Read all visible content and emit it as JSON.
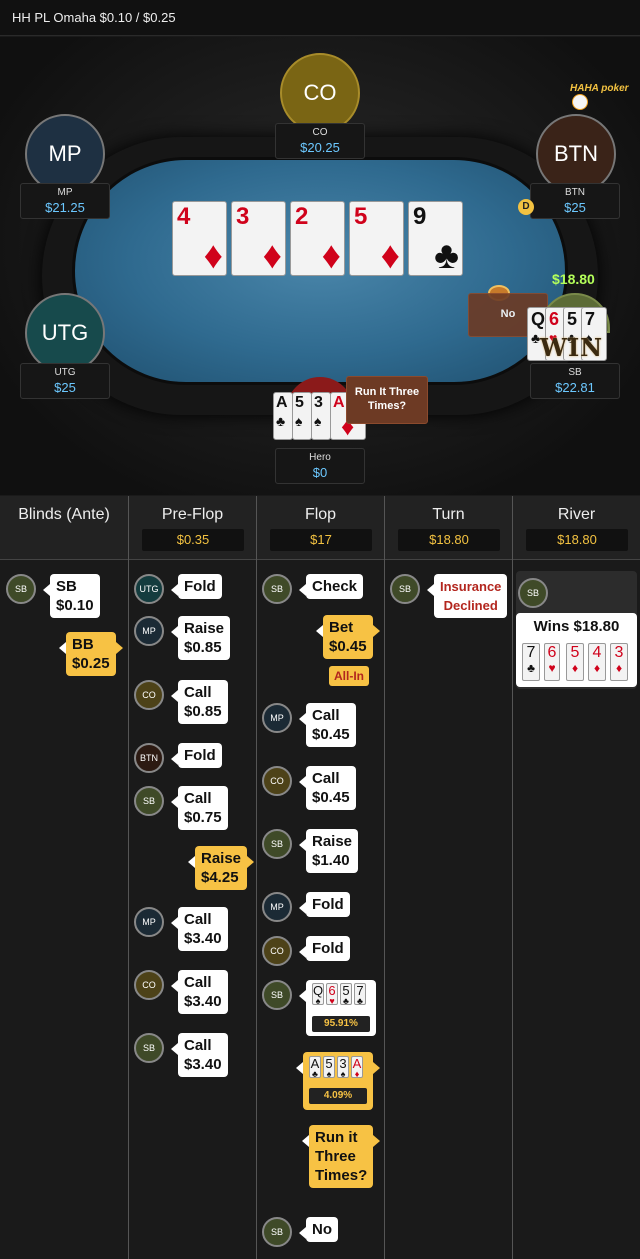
{
  "header": {
    "title": "HH PL Omaha $0.10 / $0.25"
  },
  "logo": {
    "text": "HAHA poker"
  },
  "seats": {
    "co": {
      "label": "CO",
      "name": "CO",
      "stack": "$20.25"
    },
    "mp": {
      "label": "MP",
      "name": "MP",
      "stack": "$21.25"
    },
    "btn": {
      "label": "BTN",
      "name": "BTN",
      "stack": "$25"
    },
    "utg": {
      "label": "UTG",
      "name": "UTG",
      "stack": "$25"
    },
    "sb": {
      "name": "SB",
      "stack": "$22.81",
      "cards": [
        "Q",
        "6",
        "5",
        "7"
      ],
      "win_label": "WIN",
      "pot_won": "$18.80"
    },
    "hero": {
      "name": "Hero",
      "stack": "$0",
      "cards": [
        "A",
        "5",
        "3",
        "A"
      ]
    }
  },
  "dealer": "D",
  "board": [
    {
      "rank": "4",
      "suit": "♦",
      "color": "#d0021b"
    },
    {
      "rank": "3",
      "suit": "♦",
      "color": "#d0021b"
    },
    {
      "rank": "2",
      "suit": "♦",
      "color": "#d0021b"
    },
    {
      "rank": "5",
      "suit": "♦",
      "color": "#d0021b"
    },
    {
      "rank": "9",
      "suit": "♣",
      "color": "#111111"
    }
  ],
  "table_bubbles": {
    "run_it": "Run It Three Times?",
    "no": "No"
  },
  "streets": [
    {
      "name": "Blinds (Ante)",
      "pot": ""
    },
    {
      "name": "Pre-Flop",
      "pot": "$0.35"
    },
    {
      "name": "Flop",
      "pot": "$17"
    },
    {
      "name": "Turn",
      "pot": "$18.80"
    },
    {
      "name": "River",
      "pot": "$18.80"
    }
  ],
  "actions": {
    "blinds": [
      {
        "pos": "SB",
        "line1": "SB",
        "line2": "$0.10"
      },
      {
        "pos": "Hero",
        "line1": "BB",
        "line2": "$0.25"
      }
    ],
    "preflop": [
      {
        "pos": "UTG",
        "line1": "Fold",
        "line2": ""
      },
      {
        "pos": "MP",
        "line1": "Raise",
        "line2": "$0.85"
      },
      {
        "pos": "CO",
        "line1": "Call",
        "line2": "$0.85"
      },
      {
        "pos": "BTN",
        "line1": "Fold",
        "line2": ""
      },
      {
        "pos": "SB",
        "line1": "Call",
        "line2": "$0.75"
      },
      {
        "pos": "Hero",
        "line1": "Raise",
        "line2": "$4.25"
      },
      {
        "pos": "MP",
        "line1": "Call",
        "line2": "$3.40"
      },
      {
        "pos": "CO",
        "line1": "Call",
        "line2": "$3.40"
      },
      {
        "pos": "SB",
        "line1": "Call",
        "line2": "$3.40"
      }
    ],
    "flop": [
      {
        "pos": "SB",
        "line1": "Check",
        "line2": ""
      },
      {
        "pos": "Hero",
        "line1": "Bet",
        "line2": "$0.45",
        "tag": "All-In"
      },
      {
        "pos": "MP",
        "line1": "Call",
        "line2": "$0.45"
      },
      {
        "pos": "CO",
        "line1": "Call",
        "line2": "$0.45"
      },
      {
        "pos": "SB",
        "line1": "Raise",
        "line2": "$1.40"
      },
      {
        "pos": "MP",
        "line1": "Fold",
        "line2": ""
      },
      {
        "pos": "CO",
        "line1": "Fold",
        "line2": ""
      },
      {
        "pos": "SB",
        "cards": [
          "Q",
          "6",
          "5",
          "7"
        ],
        "equity": "95.91%"
      },
      {
        "pos": "Hero",
        "cards": [
          "A",
          "5",
          "3",
          "A"
        ],
        "equity": "4.09%"
      },
      {
        "pos": "Hero",
        "line1": "Run it",
        "line2": "Three",
        "line3": "Times?"
      },
      {
        "pos": "SB",
        "line1": "No",
        "line2": ""
      }
    ],
    "turn": [
      {
        "pos": "SB",
        "line1": "Insurance",
        "line2": "Declined"
      }
    ],
    "river": [
      {
        "pos": "SB",
        "line1": "Wins $18.80",
        "cards": [
          "7",
          "6",
          "5",
          "4",
          "3"
        ]
      }
    ]
  },
  "colors": {
    "accent": "#f7c244",
    "stack": "#6cc8ff",
    "win": "#b4ff5a",
    "felt": "#2f6a8f"
  }
}
